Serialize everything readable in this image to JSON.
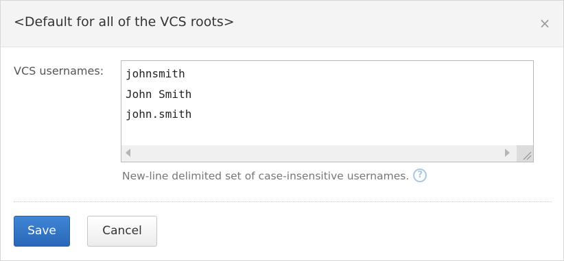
{
  "dialog": {
    "title": "<Default for all of the VCS roots>",
    "close_glyph": "×"
  },
  "form": {
    "vcs_usernames": {
      "label": "VCS usernames:",
      "value": "johnsmith\nJohn Smith\njohn.smith",
      "hint": "New-line delimited set of case-insensitive usernames.",
      "help_glyph": "?"
    }
  },
  "actions": {
    "save_label": "Save",
    "cancel_label": "Cancel"
  },
  "colors": {
    "primary_button": "#2f72c4",
    "help_icon": "#a7c8e6",
    "header_bg": "#f4f4f4"
  }
}
